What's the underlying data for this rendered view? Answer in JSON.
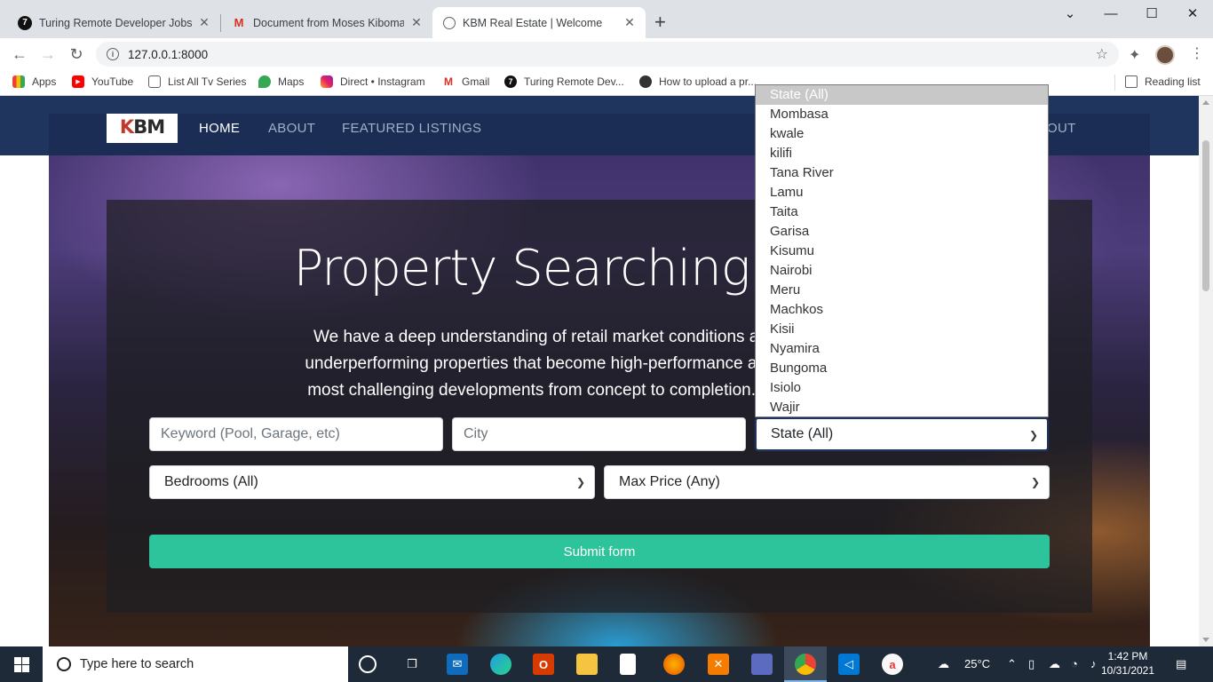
{
  "browser": {
    "tabs": [
      {
        "title": "Turing Remote Developer Jobs | A",
        "icon": "turing-icon"
      },
      {
        "title": "Document from Moses Kiboma - ",
        "icon": "gmail-icon"
      },
      {
        "title": "KBM Real Estate | Welcome",
        "icon": "globe-icon"
      }
    ],
    "url": "127.0.0.1:8000",
    "bookmarks": [
      {
        "label": "Apps",
        "icon": "apps-grid-icon"
      },
      {
        "label": "YouTube",
        "icon": "youtube-icon"
      },
      {
        "label": "List All Tv Series",
        "icon": "page-icon"
      },
      {
        "label": "Maps",
        "icon": "maps-icon"
      },
      {
        "label": "Direct • Instagram",
        "icon": "instagram-icon"
      },
      {
        "label": "Gmail",
        "icon": "gmail-icon"
      },
      {
        "label": "Turing Remote Dev...",
        "icon": "turing-icon"
      },
      {
        "label": "How to upload a pr...",
        "icon": "github-icon"
      }
    ],
    "reading_list": "Reading list"
  },
  "site": {
    "logo": {
      "k": "K",
      "rest": "BM"
    },
    "nav": [
      "HOME",
      "ABOUT",
      "FEATURED LISTINGS"
    ],
    "nav_right_fragment": "OUT",
    "headline": "Property Searching Just G",
    "lead_lines": [
      "We have a deep understanding of retail market conditions and a proven reco",
      "underperforming properties that become high-performance assets. Our experie",
      "most challenging developments from concept to completion. Land assembly, g"
    ],
    "search": {
      "keyword_placeholder": "Keyword (Pool, Garage, etc)",
      "city_placeholder": "City",
      "state_selected": "State (All)",
      "bedrooms_selected": "Bedrooms (All)",
      "price_selected": "Max Price (Any)",
      "submit_label": "Submit form"
    },
    "state_options": [
      "State (All)",
      "Mombasa",
      "kwale",
      "kilifi",
      "Tana River",
      "Lamu",
      "Taita",
      "Garisa",
      "Kisumu",
      "Nairobi",
      "Meru",
      "Machkos",
      "Kisii",
      "Nyamira",
      "Bungoma",
      "Isiolo",
      "Wajir"
    ]
  },
  "taskbar": {
    "search_placeholder": "Type here to search",
    "weather": "25°C",
    "time": "1:42 PM",
    "date": "10/31/2021"
  },
  "colors": {
    "nav_bg": "#1f355e",
    "submit_bg": "#2ec49b",
    "taskbar_bg": "#1f2a38"
  }
}
